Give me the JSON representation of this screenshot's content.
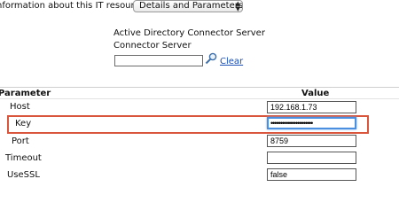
{
  "header": {
    "info_label": "nformation about this IT resource :",
    "select_value": "Details and Parameters"
  },
  "connector": {
    "title": "Active Directory Connector Server",
    "subtitle": "Connector Server",
    "input_value": "",
    "clear_label": "Clear"
  },
  "table": {
    "col_parameter": "Parameter",
    "col_value": "Value",
    "rows": [
      {
        "label": "Host",
        "value": "192.168.1.73"
      },
      {
        "label": "Key",
        "value": "••••••••••••••••••••••"
      },
      {
        "label": "Port",
        "value": "8759"
      },
      {
        "label": "Timeout",
        "value": ""
      },
      {
        "label": "UseSSL",
        "value": "false"
      }
    ]
  },
  "colors": {
    "highlight_border": "#d9553b",
    "focus_border": "#4b8fe0",
    "link": "#1a4fb5"
  }
}
